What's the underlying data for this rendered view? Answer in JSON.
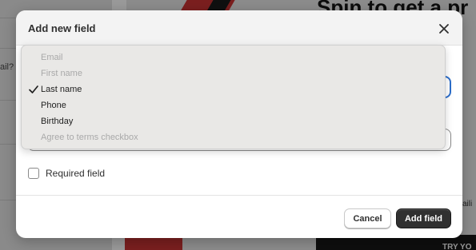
{
  "background": {
    "heading": "Spin to get a pr",
    "left_stub": "ail?",
    "right_stub": "aili",
    "bottom_stub": "TRY YO"
  },
  "modal": {
    "title": "Add new field",
    "required_label": "Required field",
    "required_checked": false,
    "cancel_label": "Cancel",
    "add_label": "Add field"
  },
  "dropdown": {
    "options": [
      {
        "label": "Email",
        "disabled": true,
        "selected": false
      },
      {
        "label": "First name",
        "disabled": true,
        "selected": false
      },
      {
        "label": "Last name",
        "disabled": false,
        "selected": true
      },
      {
        "label": "Phone",
        "disabled": false,
        "selected": false
      },
      {
        "label": "Birthday",
        "disabled": false,
        "selected": false
      },
      {
        "label": "Agree to terms checkbox",
        "disabled": true,
        "selected": false
      }
    ]
  },
  "colors": {
    "primary_button": "#303030",
    "focus_ring": "#2c6ecb",
    "overlay": "#7d7d7d"
  }
}
